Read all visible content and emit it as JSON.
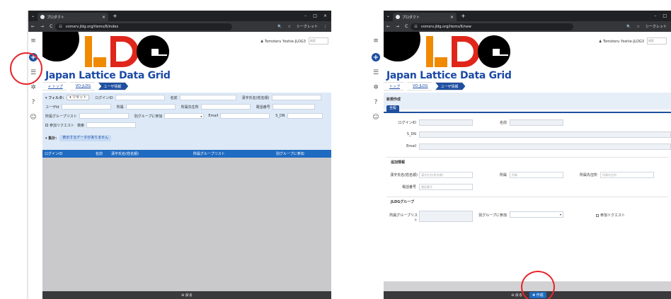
{
  "browser": {
    "tab_title": "プロダクト",
    "close": "×",
    "new_tab": "+",
    "chevron": "⌄",
    "minimize": "–",
    "maximize": "□",
    "close_window": "×",
    "back": "←",
    "forward": "→",
    "reload": "C",
    "site_info": "☷",
    "url_left": "vomsrv.jldg.org/items/6/index",
    "url_right": "vomsrv.jldg.org/items/6/new",
    "zoom": "🔍",
    "bookmark": "☆",
    "profile": "シークレット",
    "menu": "⋮"
  },
  "sidebar": {
    "menu": "≡",
    "add": "+",
    "list": "☰",
    "settings": "✲",
    "help": "?",
    "user": "☺"
  },
  "header": {
    "site_name": "Japan Lattice Data Grid",
    "user": "♟ Tomoteru Yoshie-JLDG3",
    "user_box": "検索"
  },
  "breadcrumb": {
    "home": "✔ トップ",
    "home_right": "トップ",
    "vo": "VO-JLDG",
    "current": "ユーザ情報"
  },
  "index": {
    "filter_label": "▾ フィルタ:",
    "reset": "▾ リセット",
    "login_id": "ログインID",
    "name": "名前",
    "kanji_name": "漢字氏名(姓名順)",
    "user_id": "ユーザId",
    "affiliation": "所属",
    "affiliation_address": "所属先住所",
    "phone": "電話番号",
    "group_list": "所属グループリスト",
    "other_group": "別グループに参加",
    "email": "Email",
    "sdn": "S_DN",
    "join_request": "参加リクエスト",
    "search": "検索",
    "total": "▾ 集計:",
    "no_data": "表示するデータがありません",
    "columns": [
      "ログインID",
      "名前",
      "漢字氏名(姓名順)",
      "所属グループリスト",
      "別グループに参加"
    ],
    "back": "⊖ 戻る"
  },
  "new": {
    "title": "新規作成",
    "tab": "全般",
    "login_id": "ログインID",
    "name": "名前",
    "sdn": "S_DN",
    "email": "Email",
    "section_member": "追加情報",
    "kanji_name": "漢字氏名(姓名順)",
    "kanji_placeholder": "漢字氏名(姓名順)",
    "affiliation": "所属",
    "affiliation_placeholder": "所属",
    "affiliation_address": "所属先住所",
    "address_placeholder": "所属先住所",
    "phone": "電話番号",
    "phone_placeholder": "電話番号",
    "section_group": "JLDGグループ",
    "group_list": "所属グループリスト",
    "other_group": "別グループに参加",
    "join_request": "参加リクエスト",
    "back": "⊖ 戻る",
    "create": "✚ 作成"
  },
  "colors": {
    "brand_blue": "#1f4fa0",
    "table_head": "#1f6bc1",
    "highlight_red": "#e8262c",
    "logo_orange": "#f08a00",
    "logo_red": "#e0261b"
  }
}
